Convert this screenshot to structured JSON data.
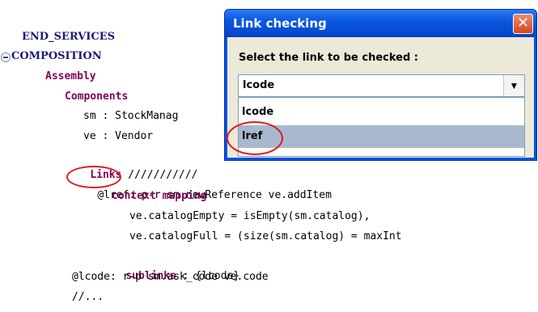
{
  "editor": {
    "lines": {
      "end_services": "END_SERVICES",
      "composition": "COMPOSITION",
      "assembly": "Assembly",
      "components": "Components",
      "sm_decl": "sm : StockManag",
      "ve_decl": "ve : Vendor",
      "links_kw": "Links",
      "links_rest": " ///////////",
      "lref_tag": "@lref:",
      "lref_rest": " p-r sm.newReference ve.addItem",
      "context_mapping": "context mapping",
      "catalog_empty": "ve.catalogEmpty = isEmpty(sm.catalog),",
      "catalog_full": "ve.catalogFull = (size(sm.catalog) = maxInt",
      "sublinks_kw": "sublinks",
      "sublinks_rest": " : {lcode}",
      "lcode_line": "@lcode: r-p sm.ask_code ve.code",
      "comment": "//..."
    }
  },
  "dialog": {
    "title": "Link checking",
    "close_glyph": "✕",
    "prompt": "Select the link to be checked :",
    "select": {
      "value": "lcode",
      "arrow": "▼",
      "options": [
        "lcode",
        "lref"
      ],
      "highlighted": "lref"
    }
  },
  "colors": {
    "keyword": "#7f0055",
    "titlebar": "#0054e3",
    "dialog_bg": "#ece9d8",
    "highlight_annotation": "#e21818"
  }
}
